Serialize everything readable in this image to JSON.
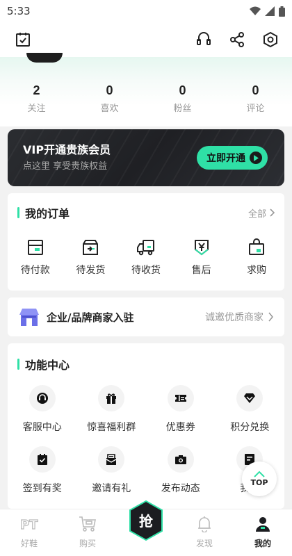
{
  "status_bar": {
    "time": "5:33"
  },
  "stats": [
    {
      "value": "2",
      "label": "关注"
    },
    {
      "value": "0",
      "label": "喜欢"
    },
    {
      "value": "0",
      "label": "粉丝"
    },
    {
      "value": "0",
      "label": "评论"
    }
  ],
  "vip": {
    "title": "VIP开通贵族会员",
    "subtitle": "点这里 享受贵族权益",
    "button": "立即开通",
    "accent": "#2fe0a6"
  },
  "orders": {
    "title": "我的订单",
    "more": "全部",
    "items": [
      {
        "label": "待付款",
        "icon": "wallet-icon"
      },
      {
        "label": "待发货",
        "icon": "box-icon"
      },
      {
        "label": "待收货",
        "icon": "truck-icon"
      },
      {
        "label": "售后",
        "icon": "yen-shield-icon"
      },
      {
        "label": "求购",
        "icon": "bag-icon"
      }
    ]
  },
  "merchant": {
    "title": "企业/品牌商家入驻",
    "link": "诚邀优质商家"
  },
  "functions": {
    "title": "功能中心",
    "items": [
      {
        "label": "客服中心",
        "icon": "service-icon"
      },
      {
        "label": "惊喜福利群",
        "icon": "gift-icon"
      },
      {
        "label": "优惠券",
        "icon": "coupon-icon"
      },
      {
        "label": "积分兑换",
        "icon": "diamond-icon"
      },
      {
        "label": "签到有奖",
        "icon": "calendar-check-icon"
      },
      {
        "label": "邀请有礼",
        "icon": "invite-icon"
      },
      {
        "label": "发布动态",
        "icon": "camera-icon"
      },
      {
        "label": "我的",
        "icon": "note-icon"
      }
    ]
  },
  "top_button": {
    "label": "TOP"
  },
  "bottom_nav": [
    {
      "label": "好鞋",
      "icon": "pt-icon"
    },
    {
      "label": "购买",
      "icon": "cart-icon"
    },
    {
      "label": "",
      "icon": "grab-icon"
    },
    {
      "label": "发现",
      "icon": "bell-icon"
    },
    {
      "label": "我的",
      "icon": "user-icon"
    }
  ]
}
